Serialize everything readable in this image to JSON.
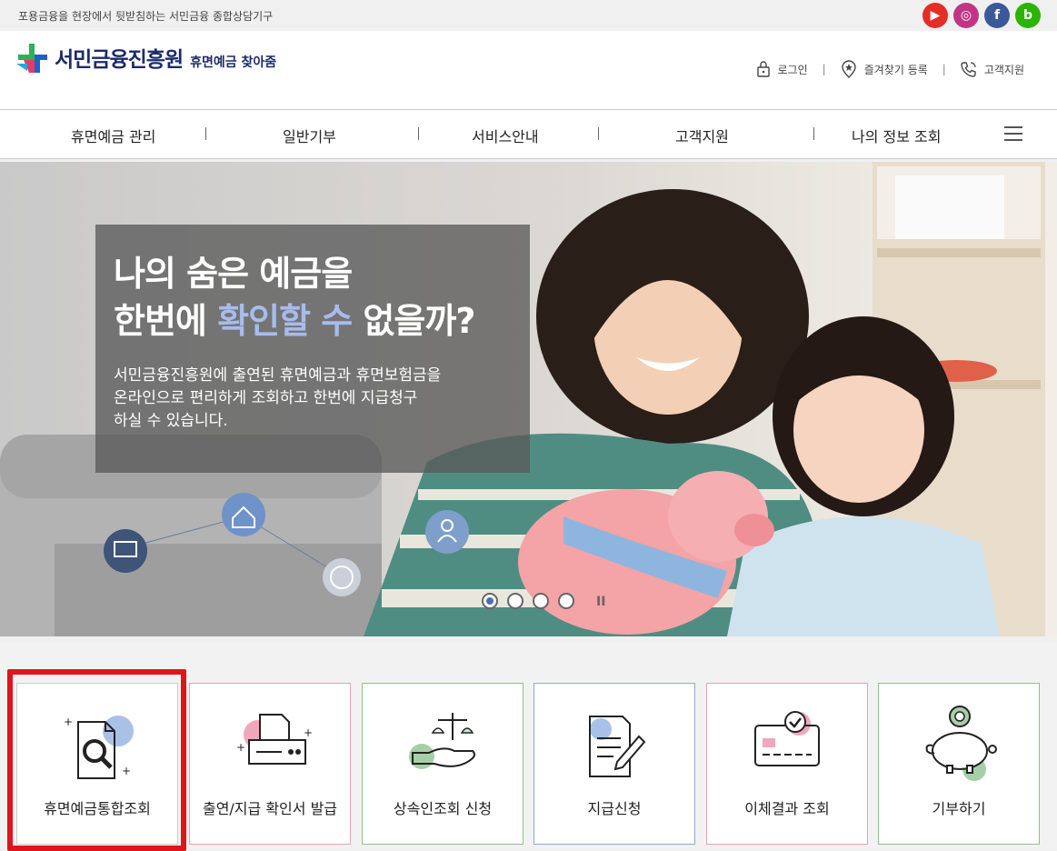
{
  "topbar": {
    "tagline": "포용금융을 현장에서 뒷받침하는 서민금융 종합상담기구",
    "social": [
      {
        "name": "youtube-icon",
        "glyph": "▶",
        "color": "#e52d27"
      },
      {
        "name": "instagram-icon",
        "glyph": "◎",
        "color": "#c13584"
      },
      {
        "name": "facebook-icon",
        "glyph": "f",
        "color": "#3b5998"
      },
      {
        "name": "blog-icon",
        "glyph": "b",
        "color": "#2db400"
      }
    ]
  },
  "header": {
    "logo_name": "서민금융진흥원",
    "logo_sub": "휴면예금 찾아줌",
    "util": {
      "login": "로그인",
      "bookmark": "즐겨찾기 등록",
      "support": "고객지원"
    }
  },
  "gnb": {
    "items": [
      "휴면예금 관리",
      "일반기부",
      "서비스안내",
      "고객지원",
      "나의 정보 조회"
    ]
  },
  "hero": {
    "line1": "나의 숨은 예금을",
    "line2_pre": "한번에 ",
    "line2_hl": "확인할 수",
    "line2_post": " 없을까?",
    "desc1": "서민금융진흥원에 출연된 휴면예금과 휴면보험금을",
    "desc2": "온라인으로 편리하게 조회하고 한번에 지급청구",
    "desc3": "하실 수 있습니다.",
    "pause": "II"
  },
  "quick": {
    "items": [
      {
        "label": "휴면예금통합조회",
        "border": "#cccccc"
      },
      {
        "label": "출연/지급 확인서 발급",
        "border": "#e6a3b4"
      },
      {
        "label": "상속인조회 신청",
        "border": "#8fbf8f"
      },
      {
        "label": "지급신청",
        "border": "#8fa8d6"
      },
      {
        "label": "이체결과 조회",
        "border": "#e6a3b4"
      },
      {
        "label": "기부하기",
        "border": "#8fbf8f"
      }
    ]
  },
  "colors": {
    "brand": "#1d2b6b",
    "highlight": "#e0141c",
    "hero_accent": "#a7bcec"
  }
}
